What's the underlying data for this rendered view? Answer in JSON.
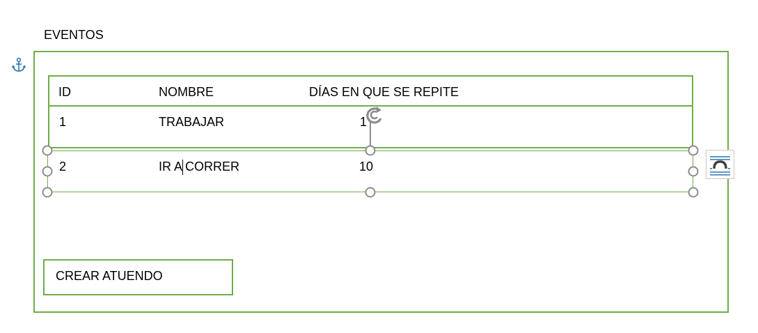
{
  "title": "EVENTOS",
  "table": {
    "headers": [
      "ID",
      "NOMBRE",
      "DÍAS EN QUE SE REPITE"
    ],
    "rows": [
      [
        "1",
        "TRABAJAR",
        "1"
      ],
      [
        "2",
        "IR A CORRER",
        "10"
      ]
    ]
  },
  "button": {
    "label": "CREAR ATUENDO"
  },
  "icons": {
    "anchor": "anchor-icon",
    "rotate": "rotate-handle-icon",
    "layout": "layout-options-icon"
  },
  "colors": {
    "frame": "#70ad47",
    "handle": "#8c8c8c",
    "accent": "#2e75b6"
  }
}
